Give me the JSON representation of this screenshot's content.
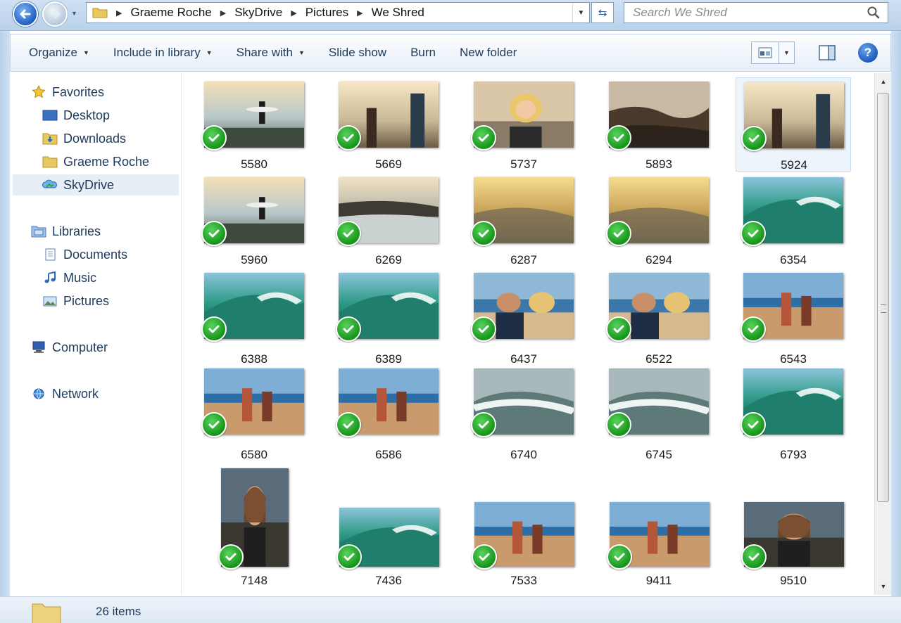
{
  "address": {
    "breadcrumbs": [
      "Graeme Roche",
      "SkyDrive",
      "Pictures",
      "We Shred"
    ]
  },
  "search": {
    "placeholder": "Search We Shred"
  },
  "toolbar": {
    "organize": "Organize",
    "include_in_library": "Include in library",
    "share_with": "Share with",
    "slide_show": "Slide show",
    "burn": "Burn",
    "new_folder": "New folder",
    "help": "?"
  },
  "sidebar": {
    "favorites": "Favorites",
    "desktop": "Desktop",
    "downloads": "Downloads",
    "graeme_roche": "Graeme Roche",
    "skydrive": "SkyDrive",
    "libraries": "Libraries",
    "documents": "Documents",
    "music": "Music",
    "pictures": "Pictures",
    "computer": "Computer",
    "network": "Network"
  },
  "files": [
    {
      "name": "5580",
      "scene": "surfer-rocks"
    },
    {
      "name": "5669",
      "scene": "people-sunset"
    },
    {
      "name": "5737",
      "scene": "blonde-portrait"
    },
    {
      "name": "5893",
      "scene": "rocks-dark"
    },
    {
      "name": "5924",
      "scene": "people-sunset"
    },
    {
      "name": "5960",
      "scene": "surfer-rocks"
    },
    {
      "name": "6269",
      "scene": "rocks-wave"
    },
    {
      "name": "6287",
      "scene": "golden-wave"
    },
    {
      "name": "6294",
      "scene": "golden-wave"
    },
    {
      "name": "6354",
      "scene": "green-wave"
    },
    {
      "name": "6388",
      "scene": "green-wave"
    },
    {
      "name": "6389",
      "scene": "green-wave"
    },
    {
      "name": "6437",
      "scene": "beach-people"
    },
    {
      "name": "6522",
      "scene": "beach-people"
    },
    {
      "name": "6543",
      "scene": "beach-sand"
    },
    {
      "name": "6580",
      "scene": "beach-sand"
    },
    {
      "name": "6586",
      "scene": "beach-sand"
    },
    {
      "name": "6740",
      "scene": "grey-wave"
    },
    {
      "name": "6745",
      "scene": "grey-wave"
    },
    {
      "name": "6793",
      "scene": "green-wave"
    },
    {
      "name": "7148",
      "scene": "portrait-dark"
    },
    {
      "name": "7436",
      "scene": "green-wave"
    },
    {
      "name": "7533",
      "scene": "beach-sand"
    },
    {
      "name": "9411",
      "scene": "beach-sand"
    },
    {
      "name": "9510",
      "scene": "portrait-dark"
    }
  ],
  "status": {
    "item_count": "26 items"
  }
}
